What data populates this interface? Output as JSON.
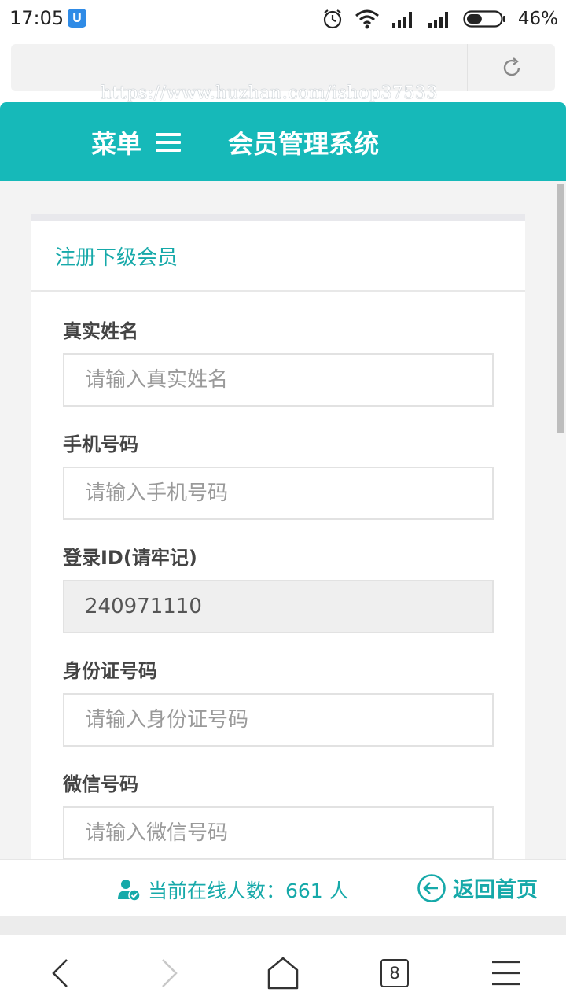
{
  "status_bar": {
    "time": "17:05",
    "battery_percent": "46%",
    "battery_level": 0.46,
    "icons": [
      "app-notification-icon",
      "alarm-icon",
      "wifi-icon",
      "signal-icon",
      "signal-icon",
      "battery-icon"
    ]
  },
  "watermark": "https://www.huzhan.com/ishop37533",
  "header": {
    "menu_label": "菜单",
    "title": "会员管理系统",
    "color": "#16b9b9"
  },
  "form": {
    "title": "注册下级会员",
    "fields": [
      {
        "label": "真实姓名",
        "placeholder": "请输入真实姓名",
        "value": ""
      },
      {
        "label": "手机号码",
        "placeholder": "请输入手机号码",
        "value": ""
      },
      {
        "label": "登录ID(请牢记)",
        "placeholder": "",
        "value": "240971110"
      },
      {
        "label": "身份证号码",
        "placeholder": "请输入身份证号码",
        "value": ""
      },
      {
        "label": "微信号码",
        "placeholder": "请输入微信号码",
        "value": ""
      }
    ]
  },
  "footer": {
    "online_label": "当前在线人数：661 人",
    "back_home_label": "返回首页"
  },
  "nav_bar": {
    "tabs_count": "8"
  }
}
